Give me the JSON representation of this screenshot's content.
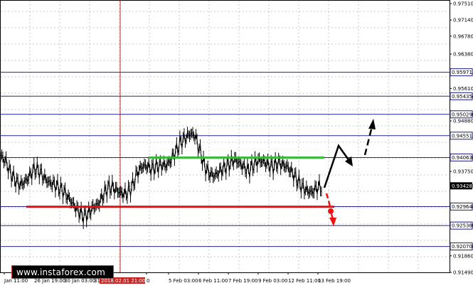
{
  "chart_data": {
    "type": "line",
    "ylim": [
      0.9149,
      0.9751
    ],
    "y_ticks": [
      "0.97510",
      "0.97140",
      "0.96780",
      "0.96380",
      "0.95971",
      "0.95610",
      "0.95435",
      "0.95029",
      "0.94880",
      "0.94551",
      "0.94063",
      "0.93750",
      "0.93428",
      "0.92964",
      "0.92538",
      "0.92070",
      "0.91860",
      "0.91490"
    ],
    "level_lines": [
      {
        "value": 0.95971,
        "label": "0.95971"
      },
      {
        "value": 0.95435,
        "label": "0.95435"
      },
      {
        "value": 0.95029,
        "label": "0.95029"
      },
      {
        "value": 0.94551,
        "label": "0.94551"
      },
      {
        "value": 0.94063,
        "label": "0.94063"
      },
      {
        "value": 0.92964,
        "label": "0.92964"
      },
      {
        "value": 0.92538,
        "label": "0.92538"
      },
      {
        "value": 0.9207,
        "label": "0.92070"
      }
    ],
    "current_price": "0.93428",
    "x_tick_labels": [
      "Jan 11:00",
      "26 Jan 19:00",
      "30 Jan 03:00",
      "31 Jan 11:00",
      "0",
      "5 Feb 03:00",
      "6 Feb 11:00",
      "7 Feb 19:00",
      "9 Feb 03:00",
      "12 Feb 11:00",
      "13 Feb 19:00"
    ],
    "highlight_x_label": "2018.02.01 21:00",
    "resistance_level": 0.9406,
    "support_level": 0.9296,
    "series": [
      {
        "values": [
          0.941,
          0.9398,
          0.9372,
          0.9355,
          0.9345,
          0.9352,
          0.9366,
          0.9382,
          0.9375,
          0.936,
          0.935,
          0.9346,
          0.9338,
          0.933,
          0.9315,
          0.93,
          0.9286,
          0.9275,
          0.928,
          0.9295,
          0.93,
          0.932,
          0.9338,
          0.934,
          0.9332,
          0.9325,
          0.9326,
          0.934,
          0.937,
          0.9385,
          0.9388,
          0.938,
          0.9386,
          0.939,
          0.9388,
          0.94,
          0.942,
          0.944,
          0.945,
          0.946,
          0.9455,
          0.942,
          0.9385,
          0.937,
          0.9365,
          0.9375,
          0.9383,
          0.9391,
          0.9402,
          0.9395,
          0.9385,
          0.9376,
          0.939,
          0.94,
          0.9398,
          0.939,
          0.9385,
          0.9395,
          0.939,
          0.9385,
          0.9372,
          0.9356,
          0.934,
          0.9332,
          0.9328,
          0.9338,
          0.9342
        ]
      }
    ]
  },
  "watermark": {
    "text": "www.instaforex.com"
  }
}
